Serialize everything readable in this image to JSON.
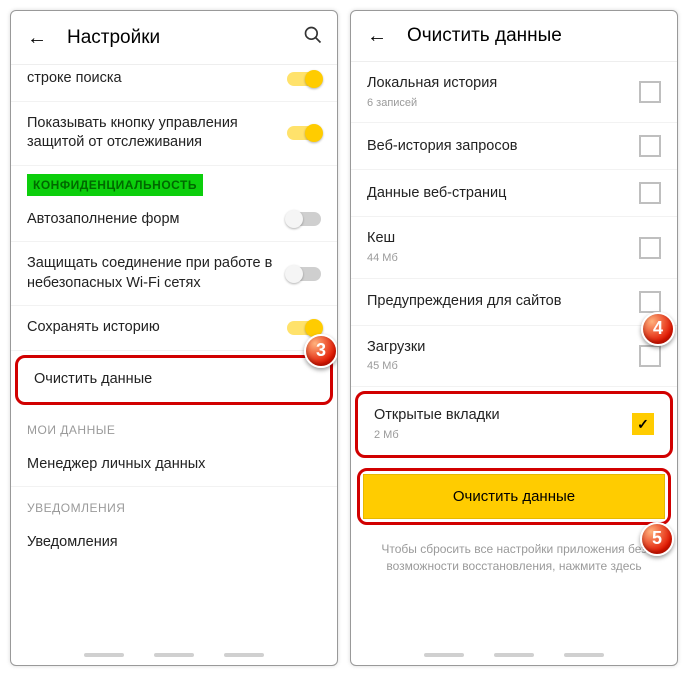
{
  "left": {
    "title": "Настройки",
    "row_clipped": "строке поиска",
    "row_tracking": "Показывать кнопку управления защитой от отслеживания",
    "section_privacy": "КОНФИДЕНЦИАЛЬНОСТЬ",
    "row_autofill": "Автозаполнение форм",
    "row_protect": "Защищать соединение при работе в небезопасных Wi-Fi сетях",
    "row_history": "Сохранять историю",
    "row_clear": "Очистить данные",
    "section_mydata": "МОИ ДАННЫЕ",
    "row_manager": "Менеджер личных данных",
    "section_notif": "УВЕДОМЛЕНИЯ",
    "row_notif": "Уведомления"
  },
  "right": {
    "title": "Очистить данные",
    "items": [
      {
        "label": "Локальная история",
        "sub": "6 записей"
      },
      {
        "label": "Веб-история запросов",
        "sub": ""
      },
      {
        "label": "Данные веб-страниц",
        "sub": ""
      },
      {
        "label": "Кеш",
        "sub": "44 Мб"
      },
      {
        "label": "Предупреждения для сайтов",
        "sub": ""
      },
      {
        "label": "Загрузки",
        "sub": "45 Мб"
      }
    ],
    "open_tabs": {
      "label": "Открытые вкладки",
      "sub": "2 Мб"
    },
    "button": "Очистить данные",
    "hint": "Чтобы сбросить все настройки приложения без возможности восстановления, нажмите здесь"
  },
  "badges": {
    "b3": "3",
    "b4": "4",
    "b5": "5"
  }
}
